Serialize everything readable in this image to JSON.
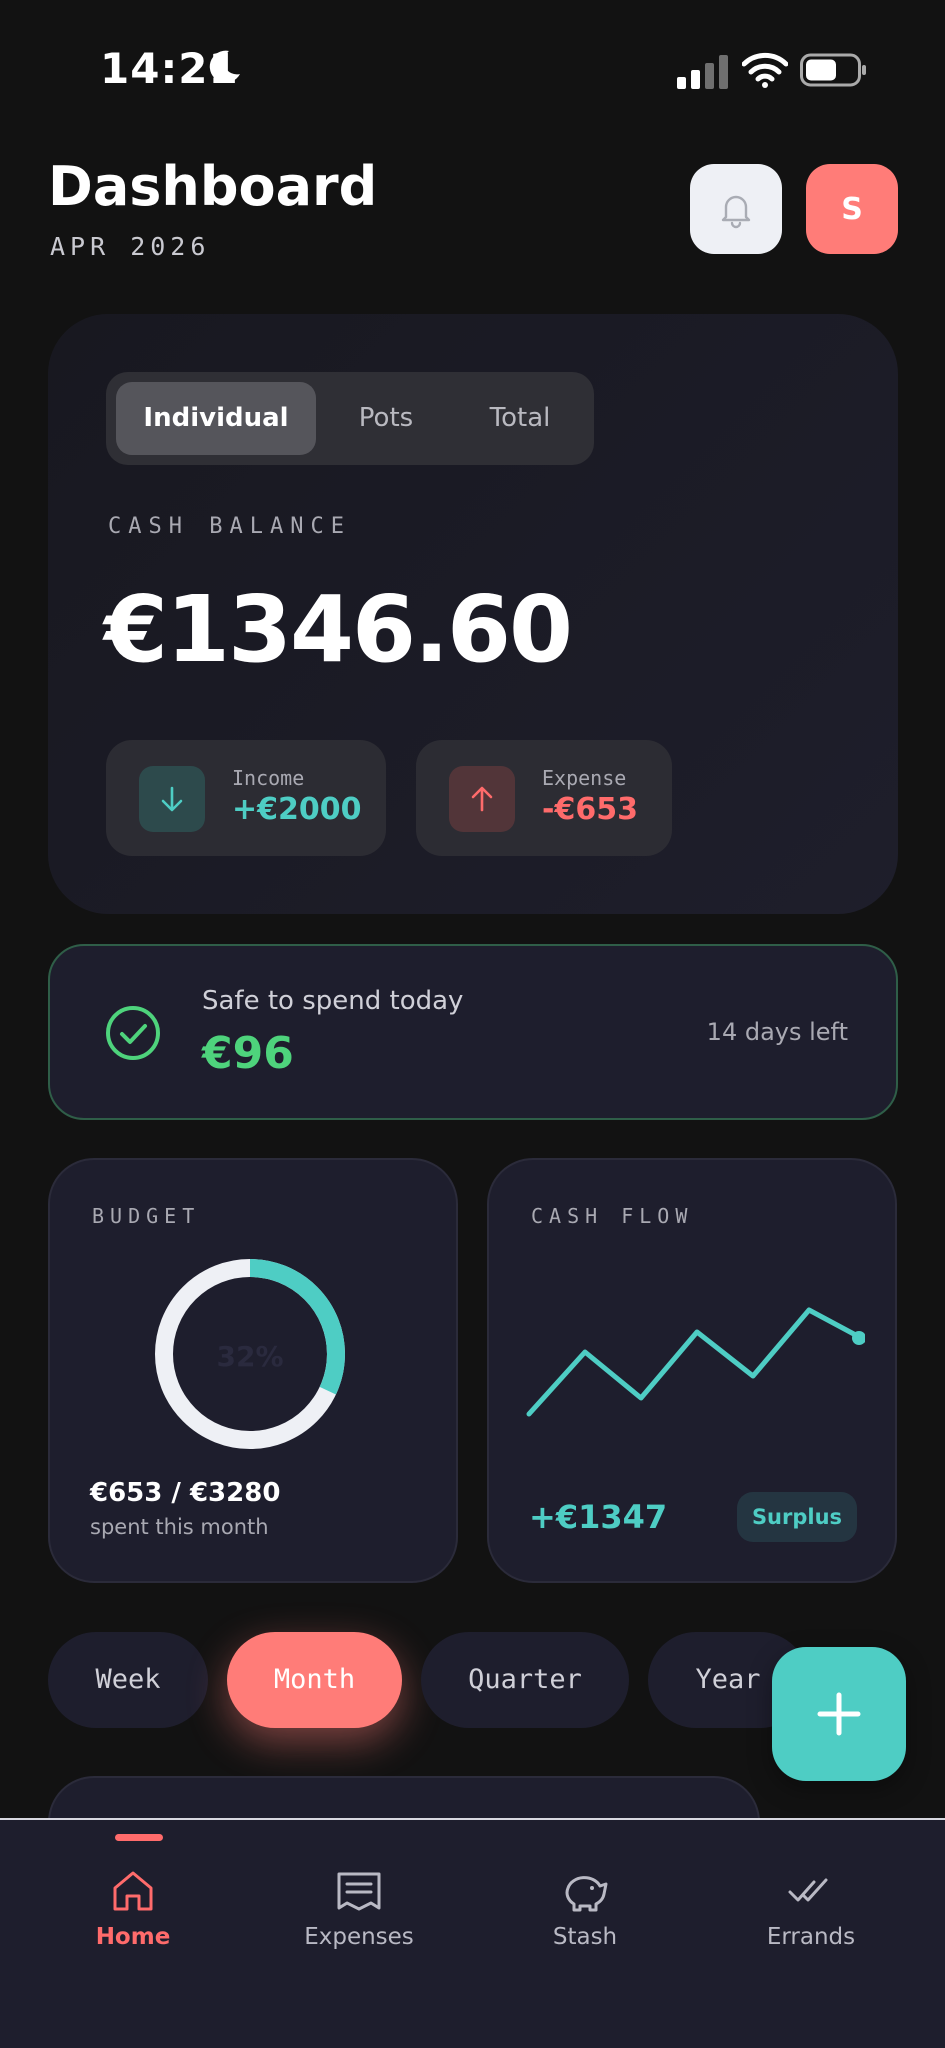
{
  "status_bar": {
    "time": "14:21"
  },
  "header": {
    "title": "Dashboard",
    "subtitle": "APR 2026",
    "avatar_initial": "S"
  },
  "balance": {
    "segments": [
      "Individual",
      "Pots",
      "Total"
    ],
    "active_segment": "Individual",
    "label": "CASH BALANCE",
    "value": "€1346.60",
    "income_label": "Income",
    "income_value": "+€2000",
    "expense_label": "Expense",
    "expense_value": "-€653"
  },
  "safe_to_spend": {
    "label": "Safe to spend today",
    "value": "€96",
    "days_left": "14 days left"
  },
  "budget": {
    "label": "BUDGET",
    "percent_label": "32%",
    "percent": 0.32,
    "amount": "€653 / €3280",
    "sub": "spent this month"
  },
  "cash_flow": {
    "label": "CASH FLOW",
    "amount": "+€1347",
    "badge": "Surplus"
  },
  "periods": {
    "items": [
      "Week",
      "Month",
      "Quarter",
      "Year"
    ],
    "active": "Month"
  },
  "tabbar": {
    "items": [
      {
        "label": "Home",
        "icon": "home-icon"
      },
      {
        "label": "Expenses",
        "icon": "receipt-icon"
      },
      {
        "label": "Stash",
        "icon": "piggy-bank-icon"
      },
      {
        "label": "Errands",
        "icon": "double-check-icon"
      }
    ],
    "active": "Home"
  },
  "colors": {
    "accent": "#ff7c78",
    "teal": "#4ecdc4",
    "green": "#4ed37c",
    "card": "#1e1e2d",
    "background": "#121212"
  }
}
